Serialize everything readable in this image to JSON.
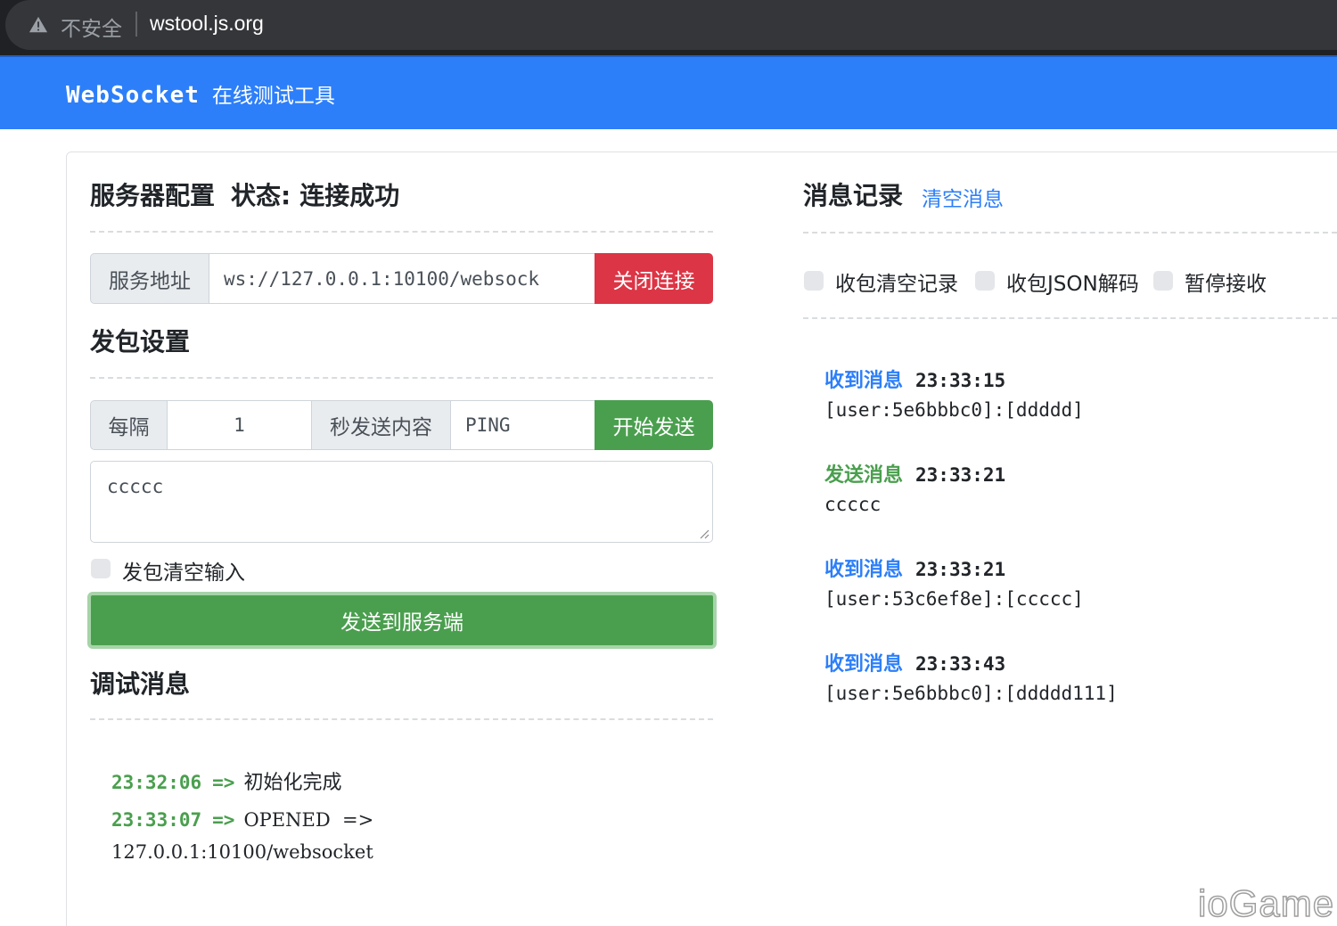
{
  "browser": {
    "security_label": "不安全",
    "url": "wstool.js.org"
  },
  "header": {
    "brand_en": "WebSocket",
    "brand_zh": "在线测试工具"
  },
  "server": {
    "title": "服务器配置",
    "status_label": "状态:",
    "status_value": "连接成功",
    "address_label": "服务地址",
    "address_value": "ws://127.0.0.1:10100/websock",
    "close_button": "关闭连接"
  },
  "send_settings": {
    "title": "发包设置",
    "interval_label": "每隔",
    "interval_value": "1",
    "content_label": "秒发送内容",
    "content_value": "PING",
    "start_button": "开始发送",
    "message_text": "ccccc",
    "clear_input_label": "发包清空输入",
    "send_button": "发送到服务端"
  },
  "debug": {
    "title": "调试消息",
    "lines": [
      {
        "time": "23:32:06",
        "arrow": "=>",
        "text": "初始化完成"
      },
      {
        "time": "23:33:07",
        "arrow": "=>",
        "text": "OPENED  =>",
        "continuation": "127.0.0.1:10100/websocket"
      }
    ]
  },
  "messages": {
    "title": "消息记录",
    "clear_link": "清空消息",
    "options": [
      {
        "label": "收包清空记录",
        "checked": false
      },
      {
        "label": "收包JSON解码",
        "checked": false
      },
      {
        "label": "暂停接收",
        "checked": false
      }
    ],
    "items": [
      {
        "kind": "收到消息",
        "type": "recv",
        "time": "23:33:15",
        "body": "[user:5e6bbbc0]:[ddddd]"
      },
      {
        "kind": "发送消息",
        "type": "send",
        "time": "23:33:21",
        "body": "ccccc"
      },
      {
        "kind": "收到消息",
        "type": "recv",
        "time": "23:33:21",
        "body": "[user:53c6ef8e]:[ccccc]"
      },
      {
        "kind": "收到消息",
        "type": "recv",
        "time": "23:33:43",
        "body": "[user:5e6bbbc0]:[ddddd111]"
      }
    ]
  },
  "watermark": "ioGame",
  "colors": {
    "primary": "#2d7ff9",
    "success": "#4a9f4e",
    "danger": "#dc3545"
  }
}
